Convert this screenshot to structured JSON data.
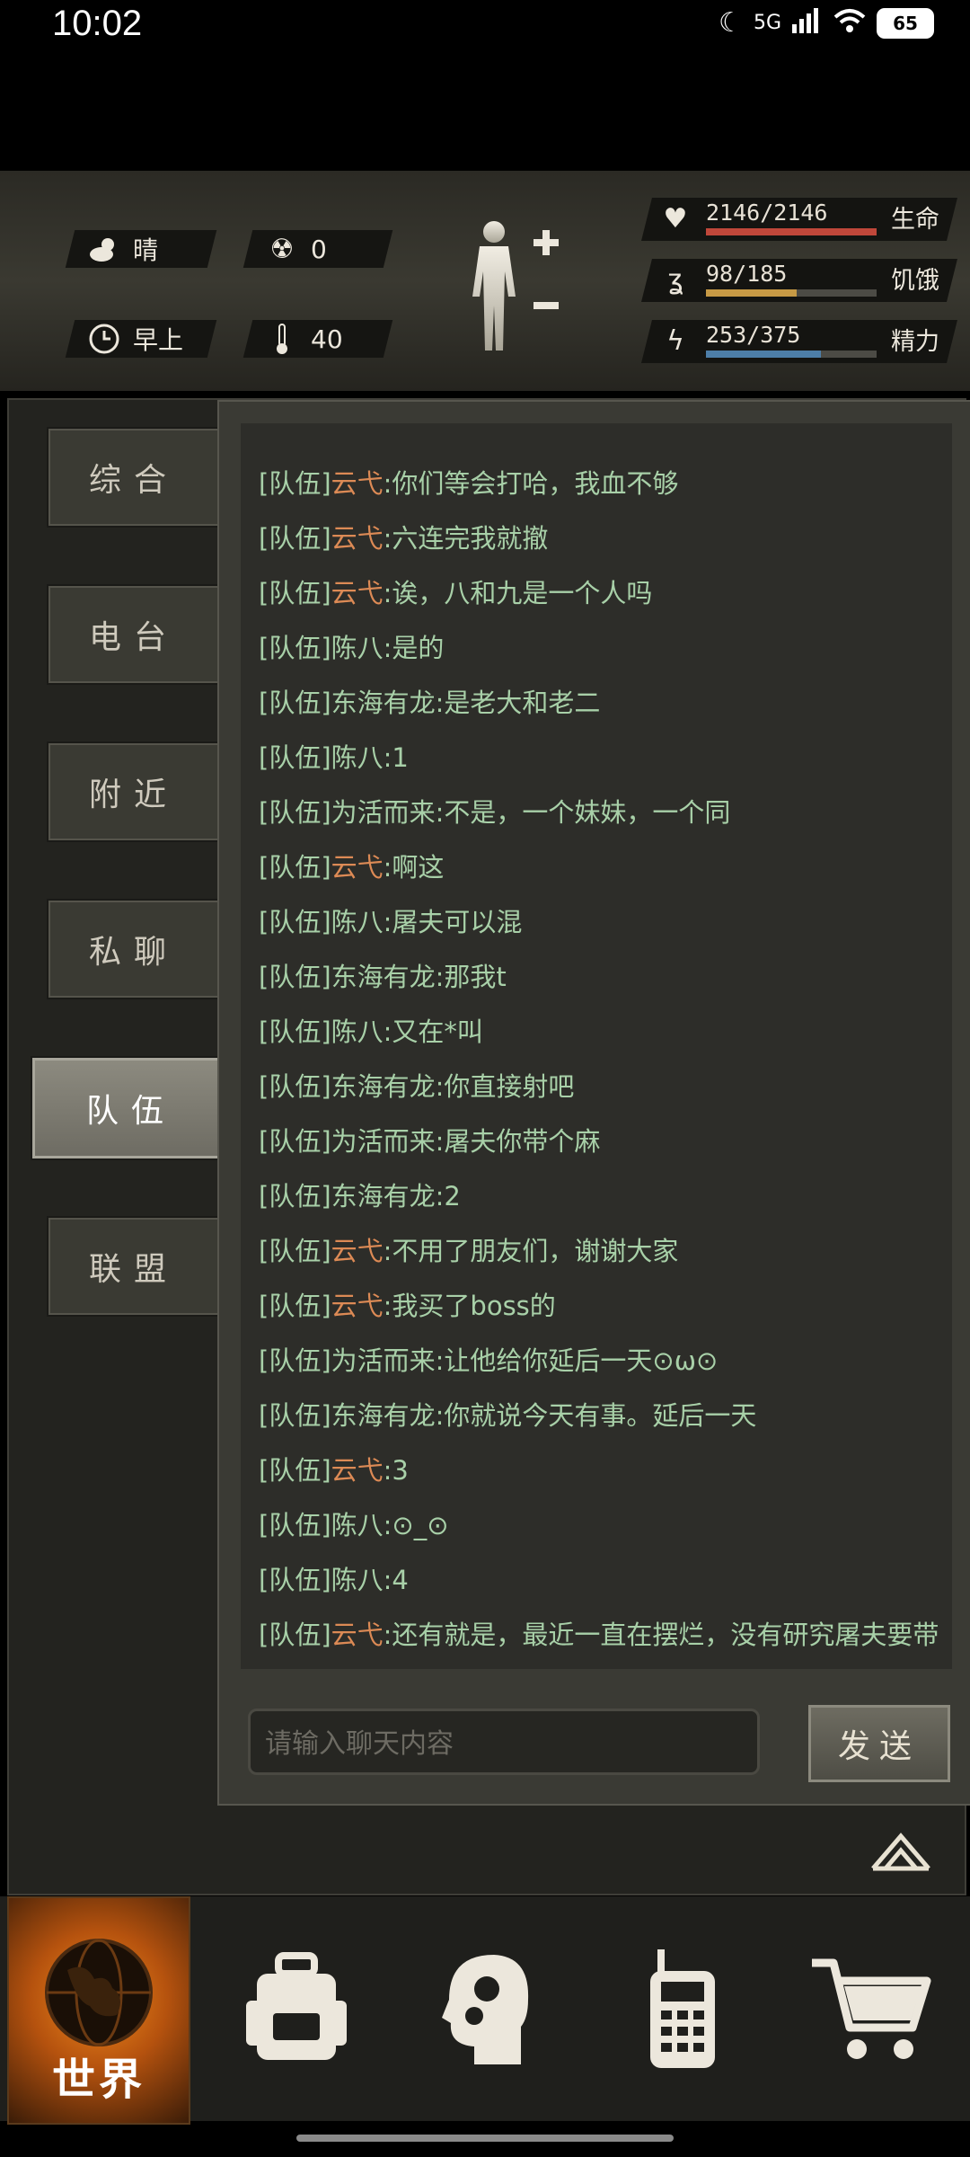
{
  "status_bar": {
    "time": "10:02",
    "network": "5G",
    "battery": "65"
  },
  "header": {
    "weather": {
      "icon": "cloud-sun-icon",
      "label": "晴"
    },
    "radiation": {
      "icon": "radiation-icon",
      "value": "0"
    },
    "time_of_day": {
      "icon": "clock-icon",
      "label": "早上"
    },
    "temperature": {
      "icon": "thermometer-icon",
      "value": "40"
    },
    "stats": [
      {
        "key": "health",
        "icon": "heart-pulse-icon",
        "value": "2146/2146",
        "label": "生命",
        "current": 2146,
        "max": 2146,
        "color": "#c0473a"
      },
      {
        "key": "hunger",
        "icon": "stomach-icon",
        "value": "98/185",
        "label": "饥饿",
        "current": 98,
        "max": 185,
        "color": "#c79a45"
      },
      {
        "key": "energy",
        "icon": "energy-head-icon",
        "value": "253/375",
        "label": "精力",
        "current": 253,
        "max": 375,
        "color": "#4d7ea8"
      }
    ]
  },
  "tabs": [
    {
      "label": "综合",
      "active": false
    },
    {
      "label": "电台",
      "active": false
    },
    {
      "label": "附近",
      "active": false
    },
    {
      "label": "私聊",
      "active": false
    },
    {
      "label": "队伍",
      "active": true
    },
    {
      "label": "联盟",
      "active": false
    }
  ],
  "chat": {
    "messages": [
      {
        "tag": "[队伍]",
        "name": "云弋",
        "text": ":你们等会打哈，我血不够",
        "highlight": true
      },
      {
        "tag": "[队伍]",
        "name": "云弋",
        "text": ":六连完我就撤",
        "highlight": true
      },
      {
        "tag": "[队伍]",
        "name": "云弋",
        "text": ":诶，八和九是一个人吗",
        "highlight": true
      },
      {
        "tag": "[队伍]",
        "name": "陈八",
        "text": ":是的",
        "highlight": false
      },
      {
        "tag": "[队伍]",
        "name": "东海有龙",
        "text": ":是老大和老二",
        "highlight": false
      },
      {
        "tag": "[队伍]",
        "name": "陈八",
        "text": ":1",
        "highlight": false
      },
      {
        "tag": "[队伍]",
        "name": "为活而来",
        "text": ":不是，一个妹妹，一个同",
        "highlight": false
      },
      {
        "tag": "[队伍]",
        "name": "云弋",
        "text": ":啊这",
        "highlight": true
      },
      {
        "tag": "[队伍]",
        "name": "陈八",
        "text": ":屠夫可以混",
        "highlight": false
      },
      {
        "tag": "[队伍]",
        "name": "东海有龙",
        "text": ":那我t",
        "highlight": false
      },
      {
        "tag": "[队伍]",
        "name": "陈八",
        "text": ":又在*叫",
        "highlight": false
      },
      {
        "tag": "[队伍]",
        "name": "东海有龙",
        "text": ":你直接射吧",
        "highlight": false
      },
      {
        "tag": "[队伍]",
        "name": "为活而来",
        "text": ":屠夫你带个麻",
        "highlight": false
      },
      {
        "tag": "[队伍]",
        "name": "东海有龙",
        "text": ":2",
        "highlight": false
      },
      {
        "tag": "[队伍]",
        "name": "云弋",
        "text": ":不用了朋友们，谢谢大家",
        "highlight": true
      },
      {
        "tag": "[队伍]",
        "name": "云弋",
        "text": ":我买了boss的",
        "highlight": true
      },
      {
        "tag": "[队伍]",
        "name": "为活而来",
        "text": ":让他给你延后一天⊙ω⊙",
        "highlight": false
      },
      {
        "tag": "[队伍]",
        "name": "东海有龙",
        "text": ":你就说今天有事。延后一天",
        "highlight": false
      },
      {
        "tag": "[队伍]",
        "name": "云弋",
        "text": ":3",
        "highlight": true
      },
      {
        "tag": "[队伍]",
        "name": "陈八",
        "text": ":⊙_⊙",
        "highlight": false
      },
      {
        "tag": "[队伍]",
        "name": "陈八",
        "text": ":4",
        "highlight": false
      },
      {
        "tag": "[队伍]",
        "name": "云弋",
        "text": ":还有就是，最近一直在摆烂，没有研究屠夫要带",
        "highlight": true
      }
    ],
    "input_placeholder": "请输入聊天内容",
    "send_label": "发送"
  },
  "bottom_nav": [
    {
      "label": "世界",
      "icon": "globe-icon",
      "active": true
    },
    {
      "label": "",
      "icon": "backpack-icon",
      "active": false
    },
    {
      "label": "",
      "icon": "head-gears-icon",
      "active": false
    },
    {
      "label": "",
      "icon": "walkie-talkie-icon",
      "active": false
    },
    {
      "label": "",
      "icon": "shopping-cart-icon",
      "active": false
    }
  ]
}
